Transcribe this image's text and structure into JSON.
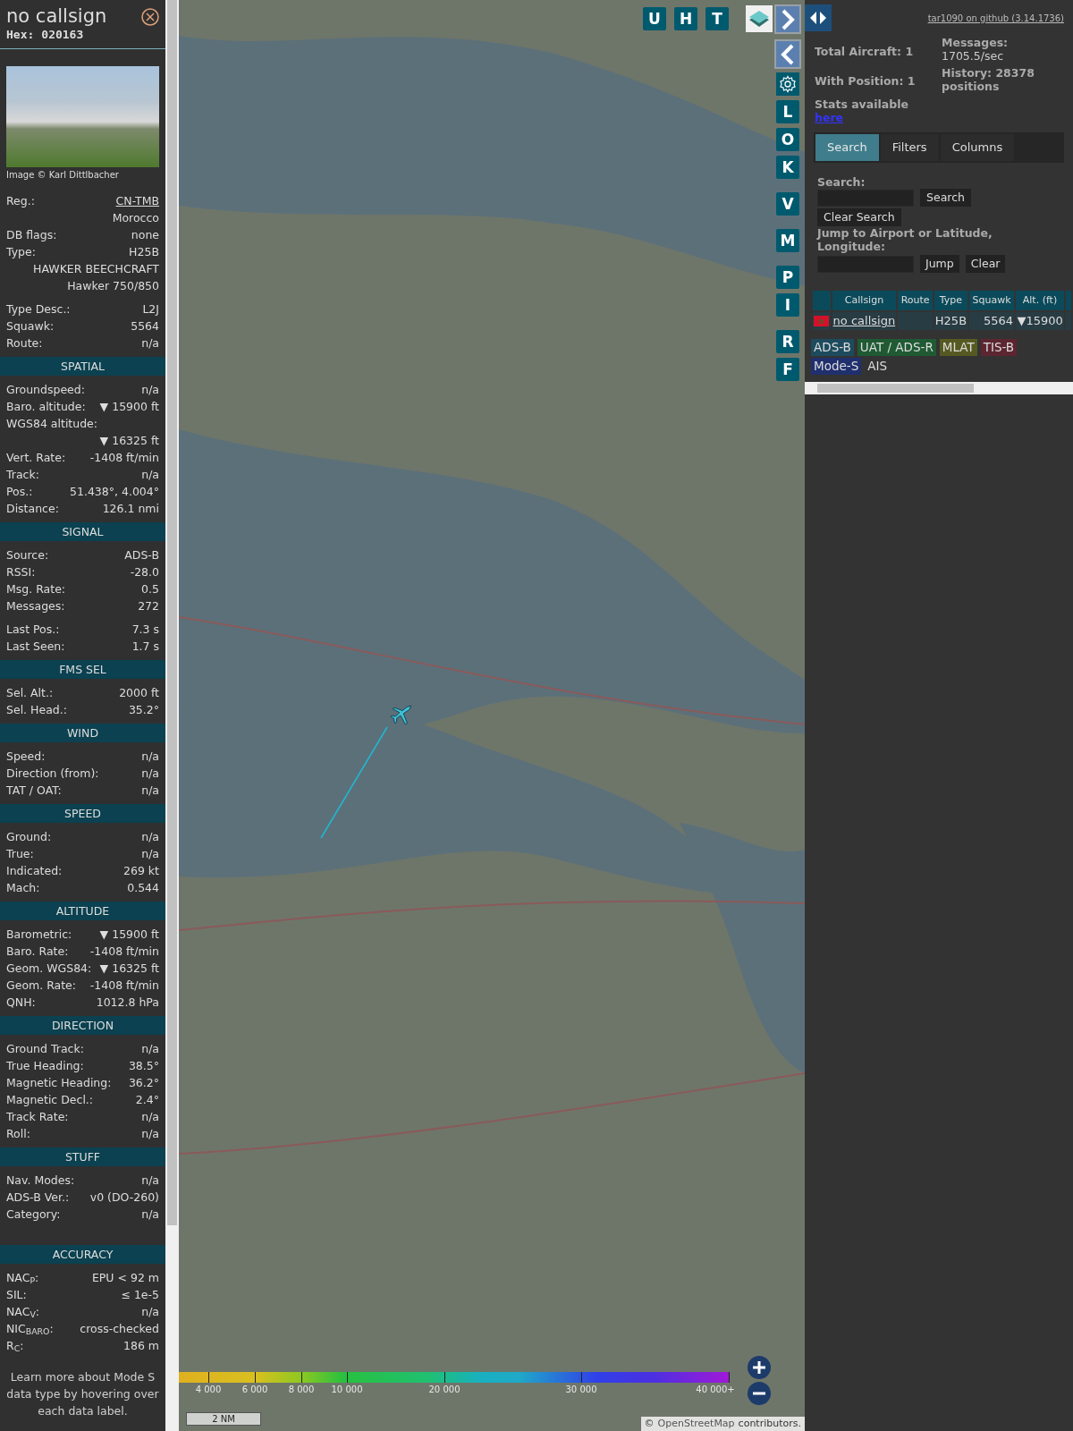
{
  "detail": {
    "title": "no callsign",
    "hex_label": "Hex:",
    "hex": "020163",
    "photo_credit": "Image © Karl Dittlbacher",
    "info_groups": [
      [
        {
          "kind": "link",
          "label": "Reg.:",
          "value": "CN-TMB"
        },
        {
          "kind": "value",
          "value": "Morocco"
        },
        {
          "kind": "pair",
          "label": "DB flags:",
          "value": "none"
        },
        {
          "kind": "pair",
          "label": "Type:",
          "value": "H25B"
        },
        {
          "kind": "value",
          "value": "HAWKER BEECHCRAFT"
        },
        {
          "kind": "value",
          "value": "Hawker 750/850"
        }
      ],
      [
        {
          "kind": "pair",
          "label": "Type Desc.:",
          "value": "L2J"
        },
        {
          "kind": "pair",
          "label": "Squawk:",
          "value": "5564"
        },
        {
          "kind": "pair",
          "label": "Route:",
          "value": "n/a"
        }
      ]
    ],
    "sections": [
      {
        "heading": "SPATIAL",
        "groups": [
          [
            {
              "kind": "pair",
              "label": "Groundspeed:",
              "value": "n/a"
            },
            {
              "kind": "pair",
              "label": "Baro. altitude:",
              "value": "▼ 15900 ft"
            },
            {
              "kind": "stacked",
              "label": "WGS84 altitude:",
              "value": "▼ 16325 ft"
            },
            {
              "kind": "pair",
              "label": "Vert. Rate:",
              "value": "-1408 ft/min"
            },
            {
              "kind": "pair",
              "label": "Track:",
              "value": "n/a"
            },
            {
              "kind": "pair",
              "label": "Pos.:",
              "value": "51.438°, 4.004°"
            },
            {
              "kind": "pair",
              "label": "Distance:",
              "value": "126.1 nmi"
            }
          ]
        ]
      },
      {
        "heading": "SIGNAL",
        "groups": [
          [
            {
              "kind": "pair",
              "label": "Source:",
              "value": "ADS-B"
            },
            {
              "kind": "pair",
              "label": "RSSI:",
              "value": "-28.0"
            },
            {
              "kind": "pair",
              "label": "Msg. Rate:",
              "value": "0.5"
            },
            {
              "kind": "pair",
              "label": "Messages:",
              "value": "272"
            }
          ],
          [
            {
              "kind": "pair",
              "label": "Last Pos.:",
              "value": "7.3 s"
            },
            {
              "kind": "pair",
              "label": "Last Seen:",
              "value": "1.7 s"
            }
          ]
        ]
      },
      {
        "heading": "FMS SEL",
        "groups": [
          [
            {
              "kind": "pair",
              "label": "Sel. Alt.:",
              "value": "2000 ft"
            },
            {
              "kind": "pair",
              "label": "Sel. Head.:",
              "value": "35.2°"
            }
          ]
        ]
      },
      {
        "heading": "WIND",
        "groups": [
          [
            {
              "kind": "pair",
              "label": "Speed:",
              "value": "n/a"
            },
            {
              "kind": "pair",
              "label": "Direction (from):",
              "value": "n/a"
            },
            {
              "kind": "pair",
              "label": "TAT / OAT:",
              "value": "n/a"
            }
          ]
        ]
      },
      {
        "heading": "SPEED",
        "groups": [
          [
            {
              "kind": "pair",
              "label": "Ground:",
              "value": "n/a"
            },
            {
              "kind": "pair",
              "label": "True:",
              "value": "n/a"
            },
            {
              "kind": "pair",
              "label": "Indicated:",
              "value": "269 kt"
            },
            {
              "kind": "pair",
              "label": "Mach:",
              "value": "0.544"
            }
          ]
        ]
      },
      {
        "heading": "ALTITUDE",
        "groups": [
          [
            {
              "kind": "pair",
              "label": "Barometric:",
              "value": "▼ 15900 ft"
            },
            {
              "kind": "pair",
              "label": "Baro. Rate:",
              "value": "-1408 ft/min"
            },
            {
              "kind": "pair",
              "label": "Geom. WGS84:",
              "value": "▼ 16325 ft"
            },
            {
              "kind": "pair",
              "label": "Geom. Rate:",
              "value": "-1408 ft/min"
            },
            {
              "kind": "pair",
              "label": "QNH:",
              "value": "1012.8 hPa"
            }
          ]
        ]
      },
      {
        "heading": "DIRECTION",
        "groups": [
          [
            {
              "kind": "pair",
              "label": "Ground Track:",
              "value": "n/a"
            },
            {
              "kind": "pair",
              "label": "True Heading:",
              "value": "38.5°"
            },
            {
              "kind": "pair",
              "label": "Magnetic Heading:",
              "value": "36.2°"
            },
            {
              "kind": "pair",
              "label": "Magnetic Decl.:",
              "value": "2.4°"
            },
            {
              "kind": "pair",
              "label": "Track Rate:",
              "value": "n/a"
            },
            {
              "kind": "pair",
              "label": "Roll:",
              "value": "n/a"
            }
          ]
        ]
      },
      {
        "heading": "STUFF",
        "groups": [
          [
            {
              "kind": "pair",
              "label": "Nav. Modes:",
              "value": "n/a"
            },
            {
              "kind": "pair",
              "label": "ADS-B Ver.:",
              "value": "v0 (DO-260)"
            },
            {
              "kind": "pair",
              "label": "Category:",
              "value": "n/a"
            }
          ]
        ],
        "spacer": true
      },
      {
        "heading": "ACCURACY",
        "groups": [
          [
            {
              "kind": "pair",
              "label": "NAC$_{P}$:",
              "value": "EPU < 92 m"
            },
            {
              "kind": "pair",
              "label": "SIL:",
              "value": "≤ 1e-5"
            },
            {
              "kind": "pair",
              "label": "NAC$_{V}$:",
              "value": "n/a"
            },
            {
              "kind": "pair",
              "label": "NIC$_{BARO}$:",
              "value": "cross-checked"
            },
            {
              "kind": "pair",
              "label": "R$_{C}$:",
              "value": "186 m"
            }
          ]
        ]
      }
    ],
    "note": "Learn more about Mode S data type by hovering over each data label."
  },
  "map": {
    "top_buttons": [
      {
        "label": "U"
      },
      {
        "label": "H"
      },
      {
        "label": "T"
      }
    ],
    "side_buttons": [
      {
        "kind": "next"
      },
      {
        "kind": "prev"
      },
      {
        "kind": "settings"
      },
      {
        "kind": "letter",
        "label": "L"
      },
      {
        "kind": "letter",
        "label": "O"
      },
      {
        "kind": "letter",
        "label": "K"
      },
      {
        "kind": "letter",
        "label": "V"
      },
      {
        "kind": "letter",
        "label": "M"
      },
      {
        "kind": "letter",
        "label": "P"
      },
      {
        "kind": "letter",
        "label": "I"
      },
      {
        "kind": "letter",
        "label": "R"
      },
      {
        "kind": "letter",
        "label": "F"
      }
    ],
    "altitude_legend": [
      "4 000",
      "6 000",
      "8 000",
      "10 000",
      "20 000",
      "30 000",
      "40 000+"
    ],
    "scale": "2 NM",
    "attribution_prefix": "©",
    "attribution_link": "OpenStreetMap",
    "attribution_suffix": "contributors."
  },
  "panel": {
    "github_link": "tar1090 on github (3.14.1736)",
    "stats": {
      "total": "Total Aircraft: 1",
      "with_position": "With Position: 1",
      "stats_text": "Stats available",
      "stats_link": "here",
      "messages_label": "Messages:",
      "messages_value": "1705.5/sec",
      "history": "History: 28378 positions"
    },
    "tabs": [
      {
        "label": "Search",
        "selected": true
      },
      {
        "label": "Filters",
        "selected": false
      },
      {
        "label": "Columns",
        "selected": false
      }
    ],
    "search": {
      "label": "Search:",
      "button": "Search",
      "clear_button": "Clear Search",
      "jump_label": "Jump to Airport or Latitude, Longitude:",
      "jump_button": "Jump",
      "jump_clear": "Clear"
    },
    "table": {
      "columns": [
        "Callsign",
        "Route",
        "Type",
        "Squawk",
        "Alt. (ft)"
      ],
      "rows": [
        {
          "callsign": "no callsign",
          "route": "",
          "type": "H25B",
          "squawk": "5564",
          "altitude": "▼15900"
        }
      ]
    },
    "sources": [
      {
        "label": "ADS-B",
        "color": "#1d4b5d"
      },
      {
        "label": "UAT / ADS-R",
        "color": "#1f5a33"
      },
      {
        "label": "MLAT",
        "color": "#565a22"
      },
      {
        "label": "TIS-B",
        "color": "#5c2530"
      },
      {
        "label": "Mode-S",
        "color": "#20306e"
      },
      {
        "label": "AIS",
        "color": "#333333"
      }
    ]
  }
}
